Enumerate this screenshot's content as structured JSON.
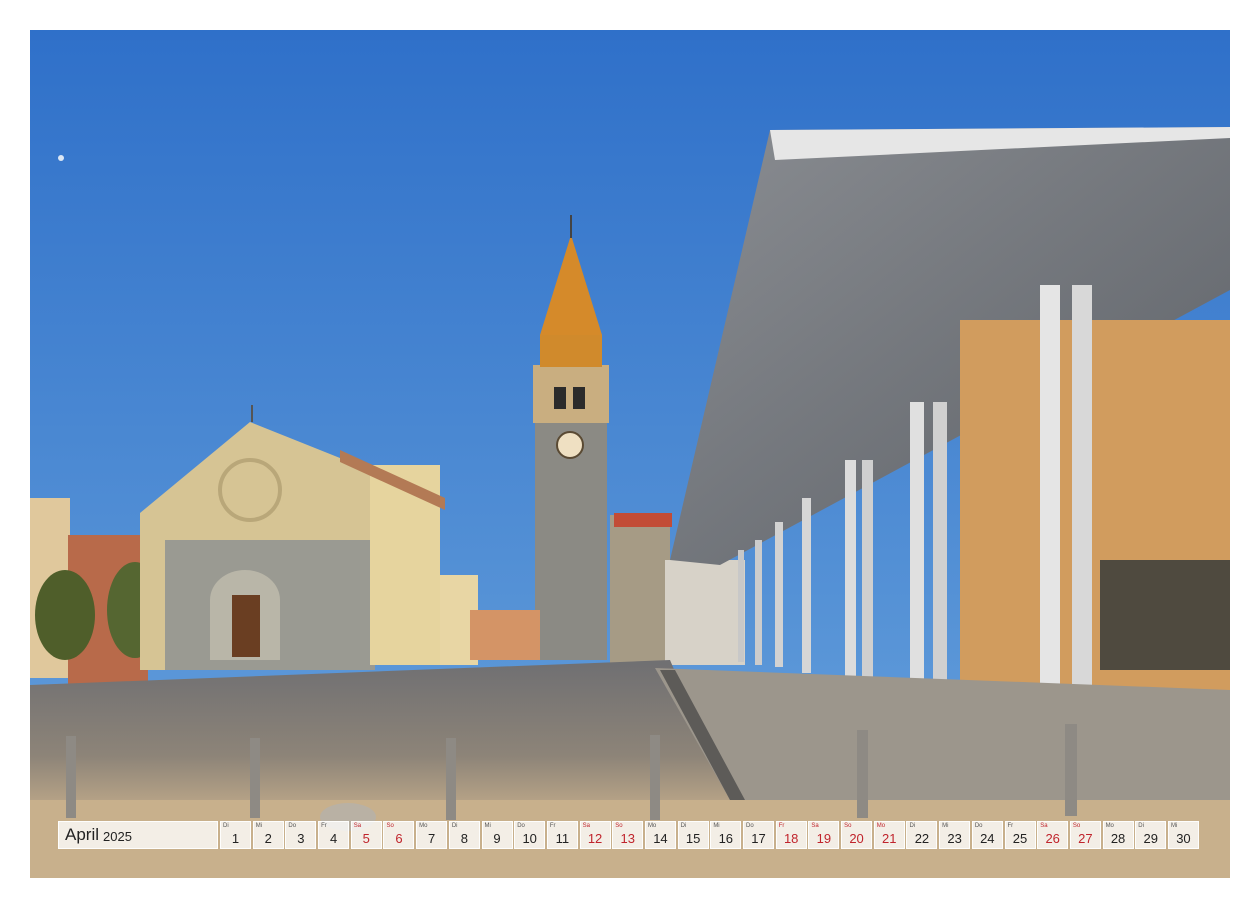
{
  "calendar": {
    "month": "April",
    "year": "2025",
    "days": [
      {
        "wd": "Di",
        "num": "1",
        "red": false
      },
      {
        "wd": "Mi",
        "num": "2",
        "red": false
      },
      {
        "wd": "Do",
        "num": "3",
        "red": false
      },
      {
        "wd": "Fr",
        "num": "4",
        "red": false
      },
      {
        "wd": "Sa",
        "num": "5",
        "red": true
      },
      {
        "wd": "So",
        "num": "6",
        "red": true
      },
      {
        "wd": "Mo",
        "num": "7",
        "red": false
      },
      {
        "wd": "Di",
        "num": "8",
        "red": false
      },
      {
        "wd": "Mi",
        "num": "9",
        "red": false
      },
      {
        "wd": "Do",
        "num": "10",
        "red": false
      },
      {
        "wd": "Fr",
        "num": "11",
        "red": false
      },
      {
        "wd": "Sa",
        "num": "12",
        "red": true
      },
      {
        "wd": "So",
        "num": "13",
        "red": true
      },
      {
        "wd": "Mo",
        "num": "14",
        "red": false
      },
      {
        "wd": "Di",
        "num": "15",
        "red": false
      },
      {
        "wd": "Mi",
        "num": "16",
        "red": false
      },
      {
        "wd": "Do",
        "num": "17",
        "red": false
      },
      {
        "wd": "Fr",
        "num": "18",
        "red": true
      },
      {
        "wd": "Sa",
        "num": "19",
        "red": true
      },
      {
        "wd": "So",
        "num": "20",
        "red": true
      },
      {
        "wd": "Mo",
        "num": "21",
        "red": true
      },
      {
        "wd": "Di",
        "num": "22",
        "red": false
      },
      {
        "wd": "Mi",
        "num": "23",
        "red": false
      },
      {
        "wd": "Do",
        "num": "24",
        "red": false
      },
      {
        "wd": "Fr",
        "num": "25",
        "red": false
      },
      {
        "wd": "Sa",
        "num": "26",
        "red": true
      },
      {
        "wd": "So",
        "num": "27",
        "red": true
      },
      {
        "wd": "Mo",
        "num": "28",
        "red": false
      },
      {
        "wd": "Di",
        "num": "29",
        "red": false
      },
      {
        "wd": "Mi",
        "num": "30",
        "red": false
      }
    ]
  },
  "colors": {
    "sky": "#3d7ed1",
    "holiday_red": "#c0242c",
    "stone": "#cbb99a"
  }
}
